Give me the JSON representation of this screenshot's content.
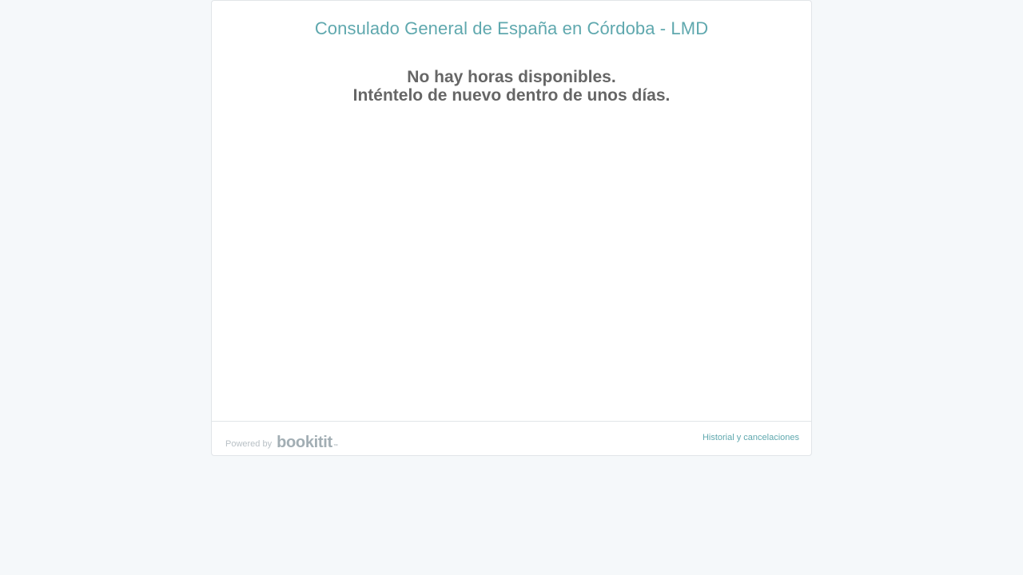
{
  "header": {
    "title": "Consulado General de España en Córdoba - LMD"
  },
  "main": {
    "message_line1": "No hay horas disponibles.",
    "message_line2": "Inténtelo de nuevo dentro de unos días."
  },
  "footer": {
    "powered_by": "Powered by",
    "logo_text": "bookitit",
    "logo_tm": "™",
    "history_link": "Historial y cancelaciones"
  },
  "colors": {
    "background": "#f5f8fa",
    "accent": "#5fa8ae",
    "message_text": "#666666",
    "logo_gray": "#a2aeb4"
  }
}
